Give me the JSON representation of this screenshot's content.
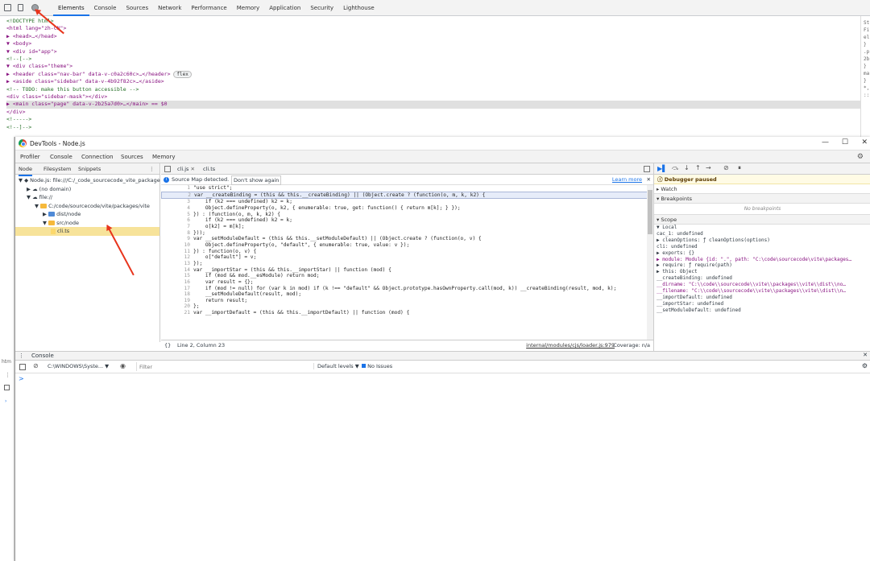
{
  "bg_devtools": {
    "tabs": [
      "Elements",
      "Console",
      "Sources",
      "Network",
      "Performance",
      "Memory",
      "Application",
      "Security",
      "Lighthouse"
    ],
    "dom_lines": [
      {
        "text": "<!DOCTYPE html>",
        "cls": "cmt"
      },
      {
        "text": "<html lang=\"zh-CN\">",
        "cls": "tag"
      },
      {
        "text": "▶ <head>…</head>",
        "cls": "tag"
      },
      {
        "text": "▼ <body>",
        "cls": "tag"
      },
      {
        "text": "  ▼ <div id=\"app\">",
        "cls": "tag"
      },
      {
        "text": "      <!--[-->",
        "cls": "cmt"
      },
      {
        "text": "    ▼ <div class=\"theme\">",
        "cls": "tag"
      },
      {
        "text": "      ▶ <header class=\"nav-bar\" data-v-c0a2c60c>…</header>",
        "cls": "tag",
        "badge": "flex"
      },
      {
        "text": "      ▶ <aside class=\"sidebar\" data-v-4b92f82c>…</aside>",
        "cls": "tag"
      },
      {
        "text": "        <!-- TODO: make this button accessible -->",
        "cls": "cmt"
      },
      {
        "text": "        <div class=\"sidebar-mask\"></div>",
        "cls": "tag"
      },
      {
        "text": "      ▶ <main class=\"page\" data-v-2b25a7d0>…</main> == $0",
        "cls": "tag",
        "sel": true
      },
      {
        "text": "      </div>",
        "cls": "tag"
      },
      {
        "text": "      <!----->",
        "cls": "cmt"
      },
      {
        "text": "      <!--]-->",
        "cls": "cmt"
      }
    ],
    "right_snips": [
      "St",
      "Fi",
      "el",
      "}",
      ".p",
      "2b",
      "}",
      "ma",
      "}",
      "*,",
      "::"
    ],
    "left_snips": [
      "htm"
    ]
  },
  "window": {
    "title": "DevTools - Node.js",
    "controls": [
      "—",
      "☐",
      "✕"
    ],
    "tabs": [
      "Profiler",
      "Console",
      "Connection",
      "Sources",
      "Memory"
    ],
    "active_tab": "Sources"
  },
  "navigator": {
    "tabs": [
      "Node",
      "Filesystem",
      "Snippets"
    ],
    "tree": [
      {
        "indent": 0,
        "label": "▼ Node.js: file:///C:/_code_sourcecode_vite_package",
        "icon": "node"
      },
      {
        "indent": 1,
        "label": "▶ (no domain)",
        "icon": "cloud"
      },
      {
        "indent": 1,
        "label": "▼ file://",
        "icon": "cloud"
      },
      {
        "indent": 2,
        "label": "▼ C:/code/sourcecode/vite/packages/vite",
        "icon": "folder"
      },
      {
        "indent": 3,
        "label": "▶ dist/node",
        "icon": "folder-blue"
      },
      {
        "indent": 3,
        "label": "▼ src/node",
        "icon": "folder"
      },
      {
        "indent": 4,
        "label": "cli.ts",
        "icon": "file",
        "selected": true
      }
    ]
  },
  "editor": {
    "tabs": [
      "cli.js",
      "cli.ts"
    ],
    "infobar": {
      "text": "Source Map detected.",
      "button": "Don't show again",
      "link": "Learn more"
    },
    "lines": [
      "\"use strict\";",
      "var __createBinding = (this && this.__createBinding) || (Object.create ? (function(o, m, k, k2) {",
      "    if (k2 === undefined) k2 = k;",
      "    Object.defineProperty(o, k2, { enumerable: true, get: function() { return m[k]; } });",
      "}) : (function(o, m, k, k2) {",
      "    if (k2 === undefined) k2 = k;",
      "    o[k2] = m[k];",
      "}));",
      "var __setModuleDefault = (this && this.__setModuleDefault) || (Object.create ? (function(o, v) {",
      "    Object.defineProperty(o, \"default\", { enumerable: true, value: v });",
      "}) : function(o, v) {",
      "    o[\"default\"] = v;",
      "});",
      "var __importStar = (this && this.__importStar) || function (mod) {",
      "    if (mod && mod.__esModule) return mod;",
      "    var result = {};",
      "    if (mod != null) for (var k in mod) if (k !== \"default\" && Object.prototype.hasOwnProperty.call(mod, k)) __createBinding(result, mod, k);",
      "    __setModuleDefault(result, mod);",
      "    return result;",
      "};",
      "var __importDefault = (this && this.__importDefault) || function (mod) {"
    ],
    "current_line": 2,
    "status": {
      "position": "Line 2, Column 23",
      "source_link": "internal/modules/cjs/loader.js:979",
      "coverage": "Coverage: n/a",
      "braces": "{}"
    }
  },
  "debugger": {
    "paused": "Debugger paused",
    "watch": "Watch",
    "breakpoints": "Breakpoints",
    "no_breakpoints": "No breakpoints",
    "scope": "Scope",
    "scope_lines": [
      "▼ Local",
      "    cac_1: undefined",
      "  ▶ cleanOptions: ƒ cleanOptions(options)",
      "    cli: undefined",
      "  ▶ exports: {}",
      "  ▶ module: Module {id: \".\", path: \"C:\\code\\sourcecode\\vite\\packages…",
      "  ▶ require: ƒ require(path)",
      "  ▶ this: Object",
      "    __createBinding: undefined",
      "    __dirname: \"C:\\\\code\\\\sourcecode\\\\vite\\\\packages\\\\vite\\\\dist\\\\no…",
      "    __filename: \"C:\\\\code\\\\sourcecode\\\\vite\\\\packages\\\\vite\\\\dist\\\\n…",
      "    __importDefault: undefined",
      "    __importStar: undefined",
      "    __setModuleDefault: undefined"
    ]
  },
  "console": {
    "drawer_tab": "Console",
    "context": "C:\\WINDOWS\\Syste... ▼",
    "filter_placeholder": "Filter",
    "levels": "Default levels ▼",
    "issues": "No Issues",
    "prompt": ">"
  },
  "colors": {
    "accent": "#1a73e8",
    "annotation_arrow": "#e8341c",
    "folder": "#f6b93b"
  }
}
